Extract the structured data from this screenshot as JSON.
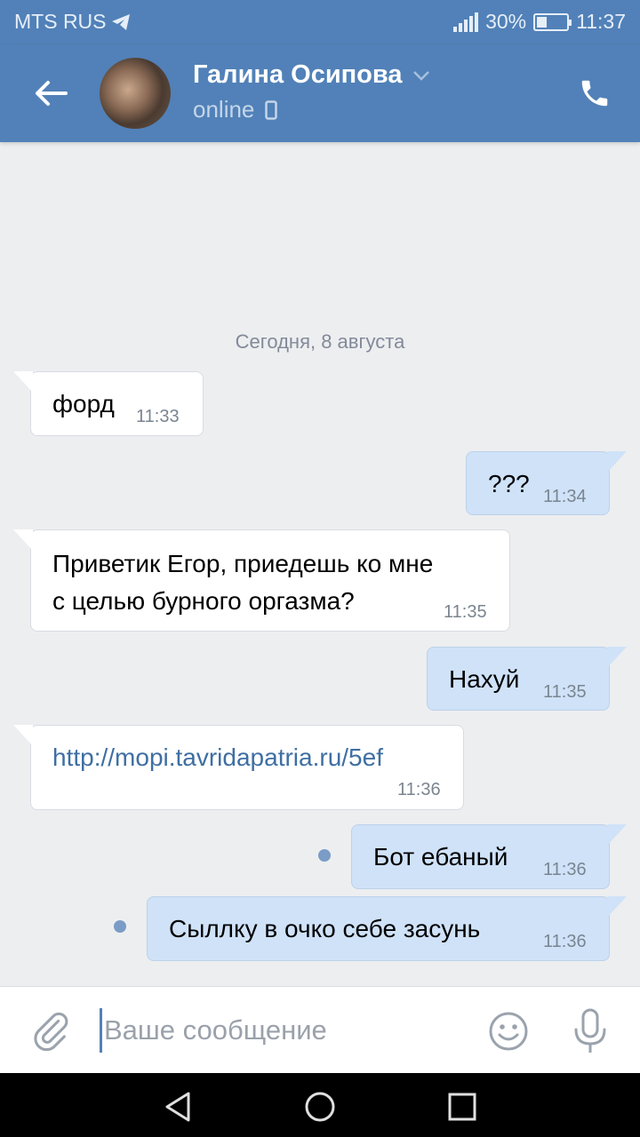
{
  "status_bar": {
    "carrier": "MTS RUS",
    "battery": "30%",
    "battery_level": 0.3,
    "time": "11:37"
  },
  "header": {
    "contact_name": "Галина Осипова",
    "status": "online"
  },
  "chat": {
    "date_separator": "Сегодня, 8 августа",
    "messages": [
      {
        "direction": "in",
        "text": "форд",
        "time": "11:33"
      },
      {
        "direction": "out",
        "text": "???",
        "time": "11:34"
      },
      {
        "direction": "in",
        "text_line1": "Приветик Егор, приедешь ко мне",
        "text_line2": "с целью бурного оргазма?",
        "time": "11:35"
      },
      {
        "direction": "out",
        "text": "Нахуй",
        "time": "11:35"
      },
      {
        "direction": "in",
        "text": "http://mopi.tavridapatria.ru/5ef",
        "time": "11:36"
      },
      {
        "direction": "out",
        "text": "Бот ебаный",
        "time": "11:36",
        "unread": true
      },
      {
        "direction": "out",
        "text": "Сыллку в очко себе засунь",
        "time": "11:36",
        "unread": true
      }
    ]
  },
  "input": {
    "placeholder": "Ваше сообщение"
  },
  "colors": {
    "header": "#5181b8",
    "background": "#edeef0",
    "incoming_bubble": "#ffffff",
    "outgoing_bubble": "#cfe2f8",
    "link": "#3f6fa3"
  },
  "icons": [
    "telegram-icon",
    "signal-icon",
    "battery-icon",
    "back-arrow-icon",
    "chevron-down-icon",
    "mobile-icon",
    "phone-icon",
    "paperclip-icon",
    "emoji-icon",
    "microphone-icon",
    "nav-back-icon",
    "nav-home-icon",
    "nav-recents-icon"
  ]
}
